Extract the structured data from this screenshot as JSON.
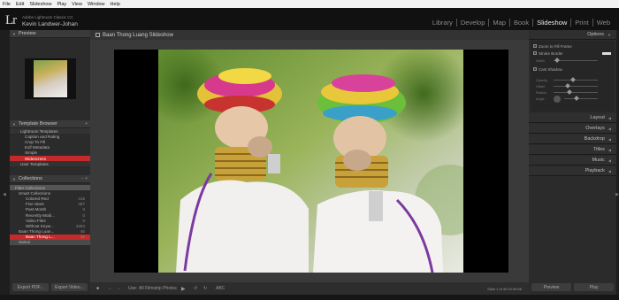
{
  "menu": [
    "File",
    "Edit",
    "Slideshow",
    "Play",
    "View",
    "Window",
    "Help"
  ],
  "identity": {
    "logo": "Lr",
    "app_name": "Adobe Lightroom Classic CC",
    "user": "Kevin Landwer-Johan"
  },
  "modules": [
    {
      "label": "Library",
      "active": false
    },
    {
      "label": "Develop",
      "active": false
    },
    {
      "label": "Map",
      "active": false
    },
    {
      "label": "Book",
      "active": false
    },
    {
      "label": "Slideshow",
      "active": true
    },
    {
      "label": "Print",
      "active": false
    },
    {
      "label": "Web",
      "active": false
    }
  ],
  "left": {
    "preview_title": "Preview",
    "template_browser_title": "Template Browser",
    "templates": [
      {
        "label": "Lightroom Templates",
        "level": 1
      },
      {
        "label": "Caption and Rating",
        "level": 2
      },
      {
        "label": "Crop To Fill",
        "level": 2
      },
      {
        "label": "Exif Metadata",
        "level": 2
      },
      {
        "label": "Simple",
        "level": 2
      },
      {
        "label": "Widescreen",
        "level": 2,
        "selected": true
      },
      {
        "label": "User Templates",
        "level": 1
      }
    ],
    "collections_title": "Collections",
    "collections": [
      {
        "label": "Filter Collections",
        "num": "",
        "level": 1,
        "hl": true
      },
      {
        "label": "Smart Collections",
        "num": "",
        "level": 2
      },
      {
        "label": "Colored Red",
        "num": "415",
        "level": 3
      },
      {
        "label": "Five Stars",
        "num": "467",
        "level": 3
      },
      {
        "label": "Past Month",
        "num": "0",
        "level": 3
      },
      {
        "label": "Recently Modi...",
        "num": "0",
        "level": 3
      },
      {
        "label": "Video Files",
        "num": "0",
        "level": 3
      },
      {
        "label": "Without Keyw...",
        "num": "4284",
        "level": 3
      },
      {
        "label": "Baan Thong Luan...",
        "num": "45",
        "level": 2
      },
      {
        "label": "Baan Thong L...",
        "num": "45",
        "level": 3,
        "selected": true
      },
      {
        "label": "Samui",
        "num": "",
        "level": 2,
        "redmark": true
      }
    ],
    "export_pdf": "Export PDF...",
    "export_video": "Export Video..."
  },
  "center": {
    "title": "Baan Thong Luang Slideshow",
    "toolbar": {
      "use_label": "Use:",
      "use_value": "All Filmstrip Photos",
      "abc": "ABC",
      "slide_count": "Slide 1 of 45  00:06:56"
    }
  },
  "right": {
    "options_title": "Options",
    "zoom_label": "Zoom to Fill Frame",
    "stroke_label": "Stroke Border",
    "stroke_width_label": "Width",
    "cast_shadow_label": "Cast Shadow",
    "shadow_sliders": [
      "Opacity",
      "Offset",
      "Radius",
      "Angle"
    ],
    "sections": [
      "Layout",
      "Overlays",
      "Backdrop",
      "Titles",
      "Music",
      "Playback"
    ],
    "preview_btn": "Preview",
    "play_btn": "Play"
  }
}
